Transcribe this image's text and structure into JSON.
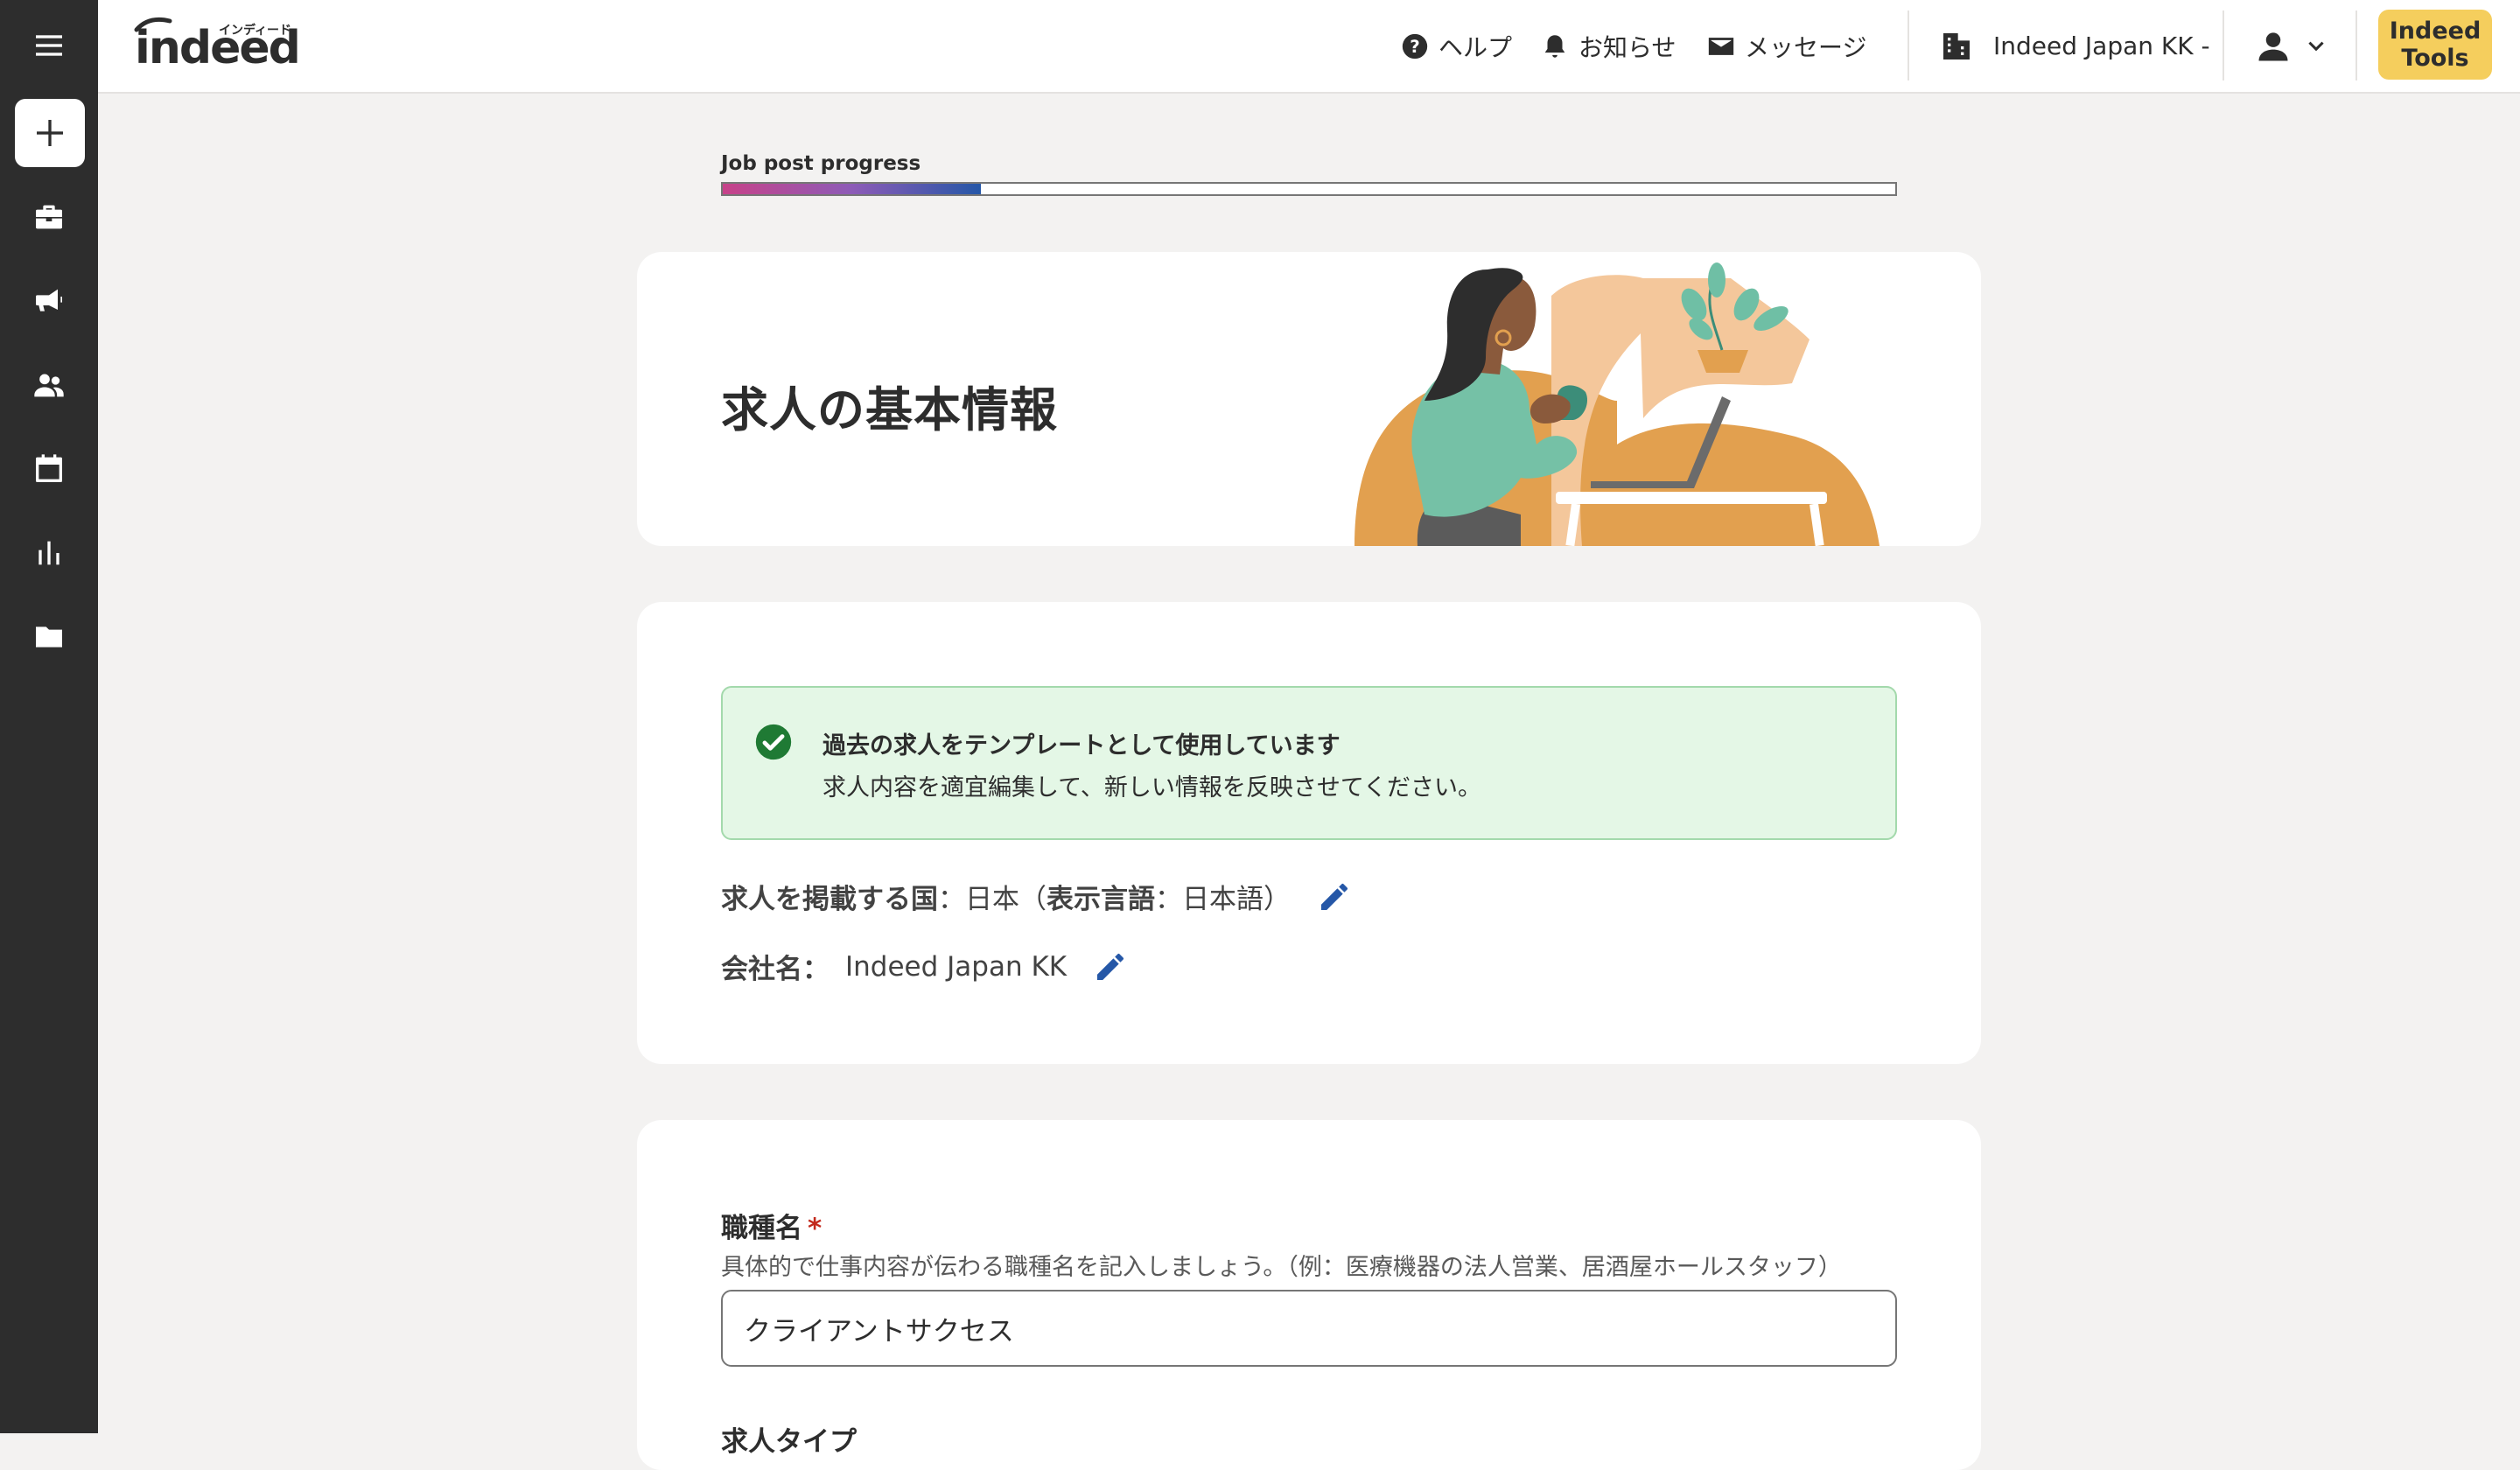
{
  "header": {
    "logo_text": "indeed",
    "logo_subtext": "インディード",
    "help_label": "ヘルプ",
    "notifications_label": "お知らせ",
    "messages_label": "メッセージ",
    "company_label": "Indeed Japan KK -",
    "tools_line1": "Indeed",
    "tools_line2": "Tools"
  },
  "sidebar": {
    "items": [
      {
        "icon": "plus-icon"
      },
      {
        "icon": "briefcase-icon"
      },
      {
        "icon": "megaphone-icon"
      },
      {
        "icon": "people-icon"
      },
      {
        "icon": "calendar-icon"
      },
      {
        "icon": "bar-chart-icon"
      },
      {
        "icon": "folder-icon"
      }
    ]
  },
  "progress": {
    "label": "Job post progress",
    "value": 0.22
  },
  "hero": {
    "title": "求人の基本情報"
  },
  "banner": {
    "title": "過去の求人をテンプレートとして使用しています",
    "text": "求人内容を適宜編集して、新しい情報を反映させてください。"
  },
  "info": {
    "country_label": "求人を掲載する国",
    "country_sep": "：",
    "country_value": "日本（",
    "language_label": "表示言語",
    "language_sep": "：",
    "language_value": "日本語）",
    "company_label": "会社名：",
    "company_value": "Indeed Japan KK"
  },
  "job_title_field": {
    "label": "職種名",
    "required_mark": "*",
    "help": "具体的で仕事内容が伝わる職種名を記入しましょう。（例：医療機器の法人営業、居酒屋ホールスタッフ）",
    "value": "クライアントサクセス"
  },
  "next_section": {
    "label": "求人タイプ"
  },
  "colors": {
    "rail": "#2d2d2d",
    "tools_button": "#f5ce5d",
    "edit_icon": "#2557a7",
    "success_bg": "#e4f7e6",
    "success_icon": "#1f7a34",
    "required": "#c3291c"
  }
}
